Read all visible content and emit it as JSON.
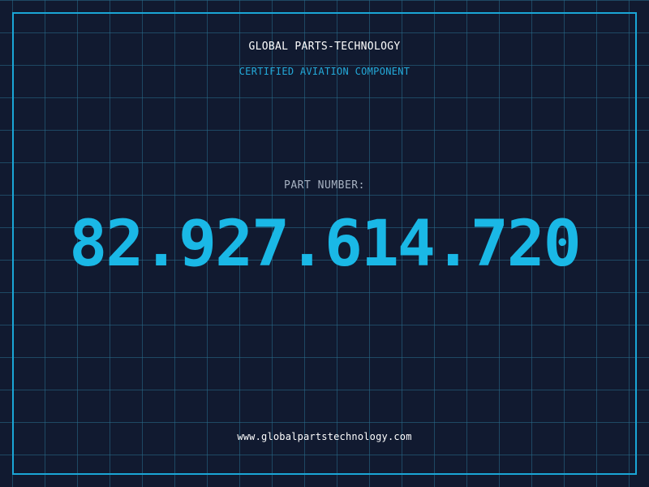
{
  "header": {
    "company": "GLOBAL PARTS-TECHNOLOGY",
    "subtitle": "CERTIFIED AVIATION COMPONENT"
  },
  "part": {
    "label": "PART NUMBER:",
    "number": "82.927.614.720"
  },
  "footer": {
    "url": "www.globalpartstechnology.com"
  },
  "colors": {
    "background": "#111a30",
    "grid": "#286e8c",
    "frame": "#1aa6d6",
    "accent": "#1ab8e6",
    "label": "#a7b2c2",
    "text": "#ffffff"
  }
}
